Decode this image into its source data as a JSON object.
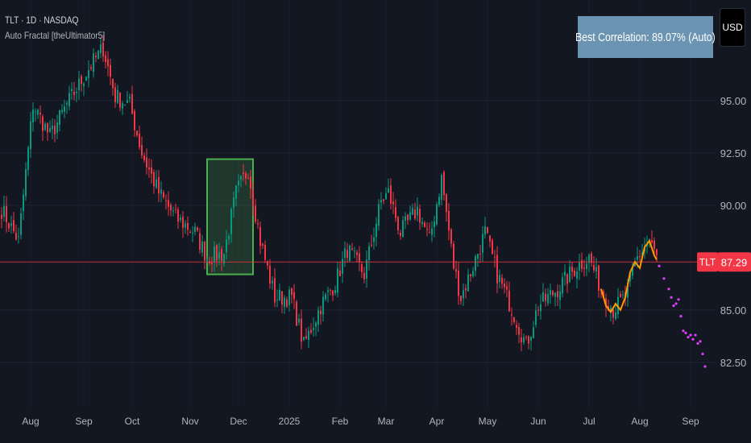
{
  "header": {
    "symbol_line": "TLT · 1D · NASDAQ",
    "indicator_line": "Auto Fractal [theUltimator5]"
  },
  "correlation_label": "Best Correlation: 89.07% (Auto)",
  "currency_button": "USD",
  "colors": {
    "background": "#131722",
    "up": "#089981",
    "down": "#f23645",
    "grid": "#1f2430",
    "fractal_line": "#ff9800",
    "projection": "#e040fb",
    "match_box": "#4caf50",
    "price_line": "#f23645"
  },
  "chart_data": {
    "type": "candlestick",
    "title": "TLT · 1D · NASDAQ",
    "xlabel": "",
    "ylabel": "",
    "ylim": [
      79.8,
      99.8
    ],
    "grid": true,
    "y_ticks": [
      "95.00",
      "92.50",
      "90.00",
      "85.00",
      "82.50"
    ],
    "y_tick_values": [
      95.0,
      92.5,
      90.0,
      85.0,
      82.5
    ],
    "x_ticks": [
      {
        "label": "Aug",
        "bar": 12
      },
      {
        "label": "Sep",
        "bar": 34
      },
      {
        "label": "Oct",
        "bar": 54
      },
      {
        "label": "Nov",
        "bar": 78
      },
      {
        "label": "Dec",
        "bar": 98
      },
      {
        "label": "2025",
        "bar": 119
      },
      {
        "label": "Feb",
        "bar": 140
      },
      {
        "label": "Mar",
        "bar": 159
      },
      {
        "label": "Apr",
        "bar": 180
      },
      {
        "label": "May",
        "bar": 201
      },
      {
        "label": "Jun",
        "bar": 222
      },
      {
        "label": "Jul",
        "bar": 243
      },
      {
        "label": "Aug",
        "bar": 264
      },
      {
        "label": "Sep",
        "bar": 285
      }
    ],
    "close_path_anchors": [
      [
        0,
        89.8
      ],
      [
        7,
        88.3
      ],
      [
        13,
        94.8
      ],
      [
        20,
        93.3
      ],
      [
        27,
        94.8
      ],
      [
        37,
        96.7
      ],
      [
        42,
        97.5
      ],
      [
        47,
        95.2
      ],
      [
        53,
        94.8
      ],
      [
        58,
        92.5
      ],
      [
        65,
        90.6
      ],
      [
        72,
        89.4
      ],
      [
        80,
        88.7
      ],
      [
        85,
        87.5
      ],
      [
        92,
        87.7
      ],
      [
        97,
        90.6
      ],
      [
        102,
        91.7
      ],
      [
        107,
        88.3
      ],
      [
        113,
        85.6
      ],
      [
        120,
        85.6
      ],
      [
        125,
        83.3
      ],
      [
        132,
        85.2
      ],
      [
        138,
        86.3
      ],
      [
        143,
        87.9
      ],
      [
        150,
        86.7
      ],
      [
        157,
        90.2
      ],
      [
        160,
        90.6
      ],
      [
        165,
        88.7
      ],
      [
        172,
        89.8
      ],
      [
        177,
        88.3
      ],
      [
        182,
        91.3
      ],
      [
        187,
        87.1
      ],
      [
        190,
        85.6
      ],
      [
        195,
        87.1
      ],
      [
        200,
        88.7
      ],
      [
        205,
        86.7
      ],
      [
        212,
        84.8
      ],
      [
        217,
        83.3
      ],
      [
        222,
        85.2
      ],
      [
        230,
        86.0
      ],
      [
        238,
        87.1
      ],
      [
        243,
        87.5
      ],
      [
        248,
        86.0
      ],
      [
        253,
        85.0
      ],
      [
        258,
        85.6
      ],
      [
        263,
        87.5
      ],
      [
        268,
        88.3
      ],
      [
        271,
        87.5
      ]
    ],
    "last_price": {
      "symbol": "TLT",
      "value": "87.29",
      "price": 87.29
    },
    "match_window": {
      "start_bar": 85,
      "end_bar": 104,
      "high": 92.2,
      "low": 86.7
    },
    "fractal_overlay": [
      [
        248,
        86.0
      ],
      [
        250,
        85.2
      ],
      [
        252,
        84.9
      ],
      [
        254,
        85.3
      ],
      [
        256,
        85.0
      ],
      [
        258,
        85.6
      ],
      [
        260,
        86.8
      ],
      [
        262,
        87.3
      ],
      [
        264,
        87.0
      ],
      [
        266,
        88.0
      ],
      [
        268,
        88.3
      ],
      [
        270,
        87.6
      ],
      [
        271,
        87.4
      ]
    ],
    "projection": [
      [
        272,
        87.1
      ],
      [
        274,
        86.5
      ],
      [
        276,
        86.0
      ],
      [
        277,
        85.6
      ],
      [
        278,
        85.2
      ],
      [
        279,
        85.3
      ],
      [
        280,
        85.5
      ],
      [
        281,
        84.7
      ],
      [
        282,
        84.0
      ],
      [
        283,
        83.9
      ],
      [
        284,
        83.7
      ],
      [
        285,
        83.8
      ],
      [
        286,
        83.6
      ],
      [
        287,
        83.8
      ],
      [
        288,
        83.4
      ],
      [
        289,
        83.5
      ],
      [
        290,
        82.9
      ],
      [
        291,
        82.3
      ]
    ]
  }
}
